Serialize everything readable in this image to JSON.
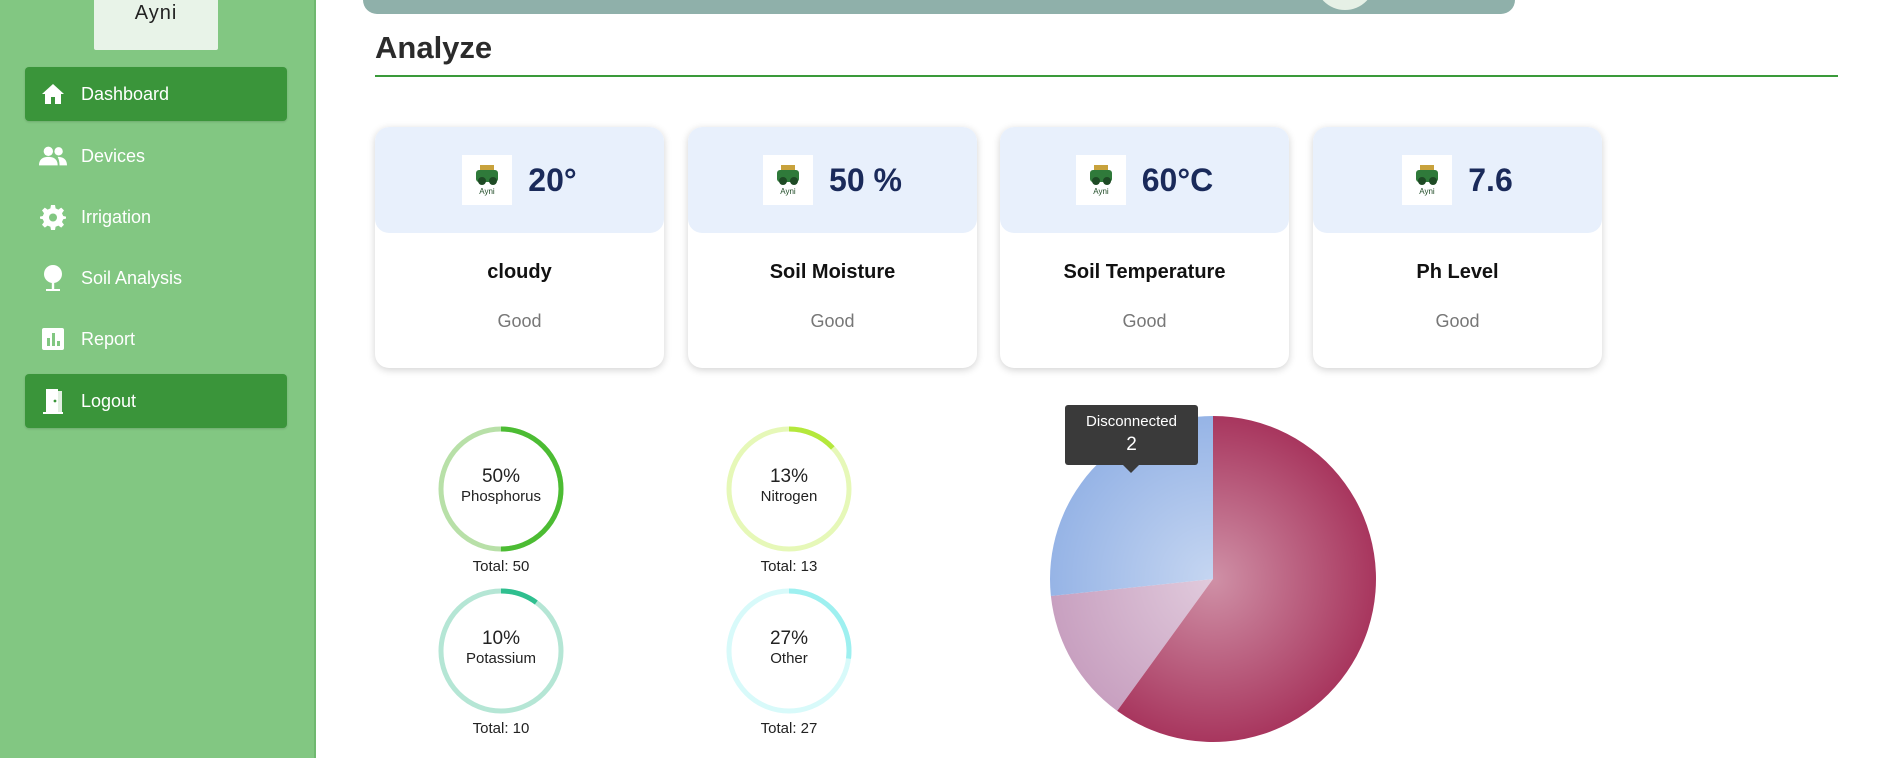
{
  "app": {
    "logo_text": "Ayni"
  },
  "sidebar": {
    "items": [
      {
        "label": "Dashboard",
        "icon": "home-icon",
        "active": true
      },
      {
        "label": "Devices",
        "icon": "people-icon",
        "active": false
      },
      {
        "label": "Irrigation",
        "icon": "gear-icon",
        "active": false
      },
      {
        "label": "Soil Analysis",
        "icon": "tree-icon",
        "active": false
      },
      {
        "label": "Report",
        "icon": "bar-chart-icon",
        "active": false
      },
      {
        "label": "Logout",
        "icon": "door-exit-icon",
        "active": true
      }
    ]
  },
  "main": {
    "title": "Analyze",
    "cards": [
      {
        "value": "20°",
        "label": "cloudy",
        "status": "Good",
        "icon_text": "Ayni"
      },
      {
        "value": "50 %",
        "label": "Soil Moisture",
        "status": "Good",
        "icon_text": "Ayni"
      },
      {
        "value": "60°C",
        "label": "Soil Temperature",
        "status": "Good",
        "icon_text": "Ayni"
      },
      {
        "value": "7.6",
        "label": "Ph Level",
        "status": "Good",
        "icon_text": "Ayni"
      }
    ],
    "gauges": [
      {
        "percent": "50%",
        "percent_value": 50,
        "name": "Phosphorus",
        "total": "Total: 50",
        "color": "#4cbc33",
        "track": "#b8e0a8"
      },
      {
        "percent": "13%",
        "percent_value": 13,
        "name": "Nitrogen",
        "total": "Total: 13",
        "color": "#b4e83c",
        "track": "#e6f8b8"
      },
      {
        "percent": "10%",
        "percent_value": 10,
        "name": "Potassium",
        "total": "Total: 10",
        "color": "#2fbf8f",
        "track": "#b5e6d5"
      },
      {
        "percent": "27%",
        "percent_value": 27,
        "name": "Other",
        "total": "Total: 27",
        "color": "#9ef0f0",
        "track": "#d8fafa"
      }
    ],
    "tooltip": {
      "label": "Disconnected",
      "value": "2"
    }
  },
  "chart_data": {
    "type": "pie",
    "slices": [
      {
        "name": "Disconnected",
        "value": 2,
        "color": "#c8a0c0"
      },
      {
        "name": "",
        "value": 4,
        "color": "#96b4e6"
      },
      {
        "name": "",
        "value": 9,
        "color": "#a8365e"
      }
    ]
  }
}
